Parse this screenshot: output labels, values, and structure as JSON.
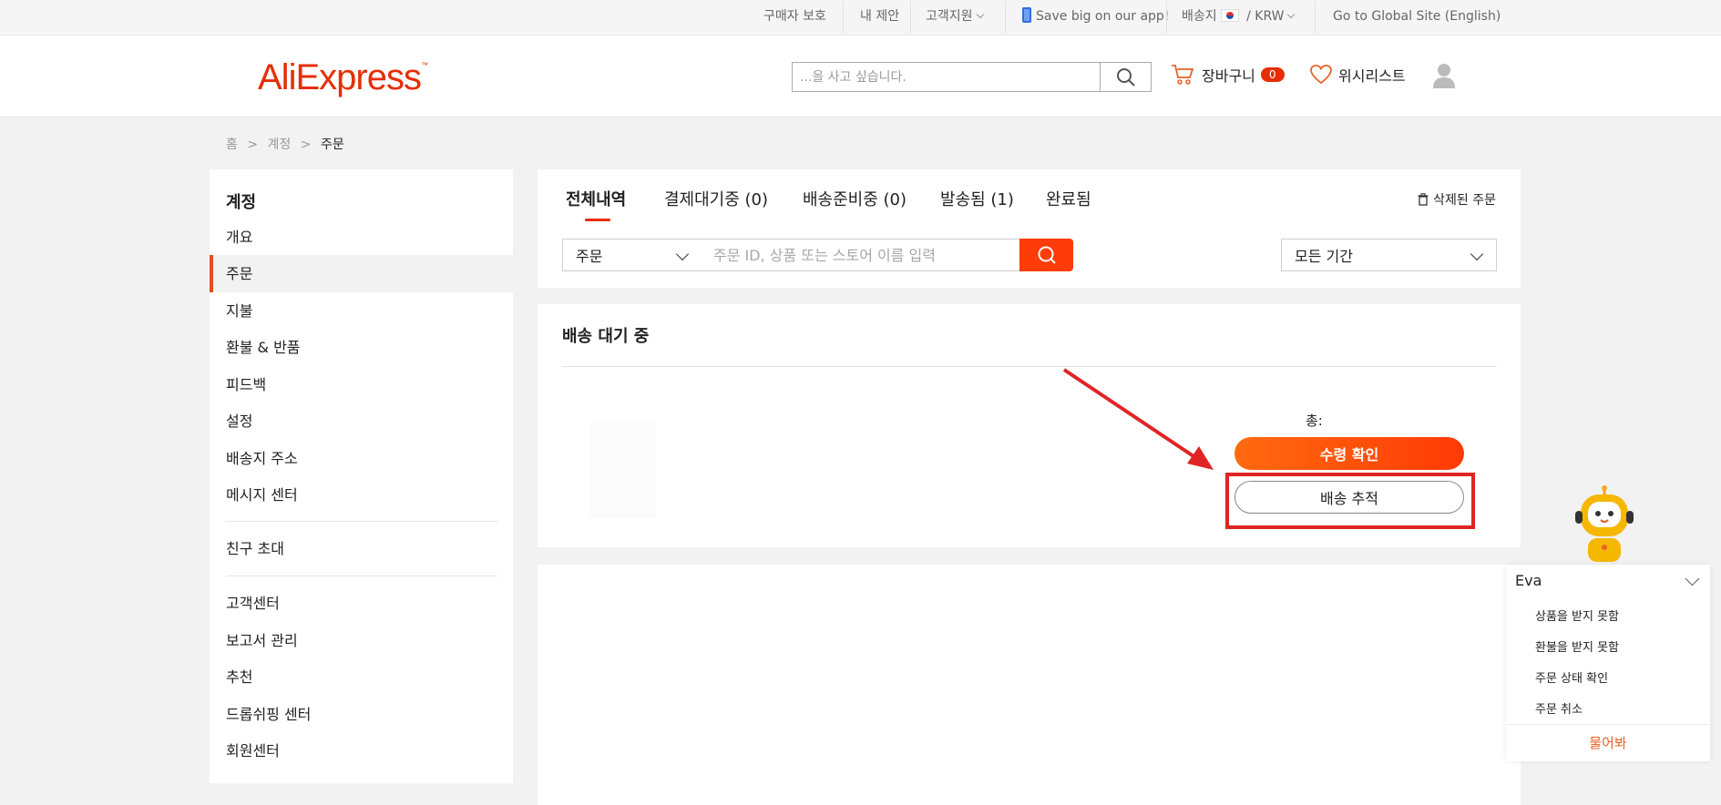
{
  "topbar": {
    "buyer_protection": "구매자 보호",
    "my_offers": "내 제안",
    "customer_service": "고객지원",
    "app_promo": "Save big on our app!",
    "ship_to": "배송지",
    "currency": "KRW",
    "global_site": "Go to Global Site (English)"
  },
  "header": {
    "logo": "AliExpress",
    "search_placeholder": "...을 사고 싶습니다.",
    "cart_label": "장바구니",
    "cart_count": "0",
    "wishlist_label": "위시리스트"
  },
  "breadcrumb": [
    "홈",
    ">",
    "계정",
    ">",
    "주문"
  ],
  "sidebar": {
    "title": "계정",
    "items": [
      "개요",
      "주문",
      "지불",
      "환불 & 반품",
      "피드백",
      "설정",
      "배송지 주소",
      "메시지 센터",
      "친구 초대",
      "고객센터",
      "보고서 관리",
      "추천",
      "드롭쉬핑 센터",
      "회원센터"
    ],
    "active_index": 1
  },
  "orders": {
    "tabs": [
      "전체내역",
      "결제대기중 (0)",
      "배송준비중 (0)",
      "발송됨 (1)",
      "완료됨"
    ],
    "active_tab": 0,
    "deleted_orders": "삭제된 주문",
    "filter_select": "주문",
    "search_placeholder": "주문 ID, 상품 또는 스토어 이름 입력",
    "period_select": "모든 기간",
    "order_status": "배송 대기 중",
    "total_label": "총:",
    "confirm_button": "수령 확인",
    "track_button": "배송 추적"
  },
  "chatbot": {
    "title": "Eva",
    "options": [
      "상품을 받지 못함",
      "환불을 받지 못함",
      "주문 상태 확인",
      "주문 취소"
    ],
    "ask_button": "물어봐"
  },
  "colors": {
    "accent": "#e62e04",
    "button_gradient_start": "#ff6a10",
    "button_gradient_end": "#ff3a05",
    "annotation_red": "#e02424"
  }
}
